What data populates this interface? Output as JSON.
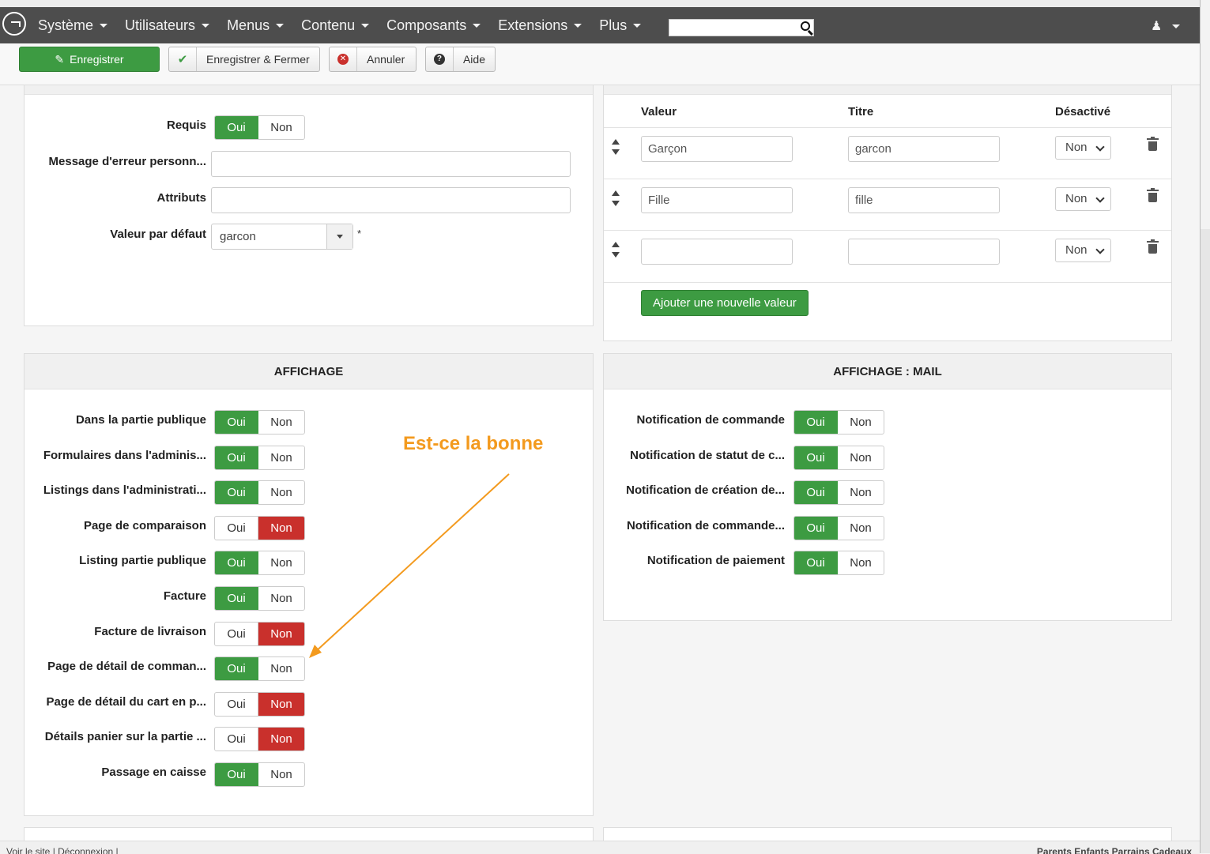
{
  "nav": {
    "items": [
      "Système",
      "Utilisateurs",
      "Menus",
      "Contenu",
      "Composants",
      "Extensions",
      "Plus"
    ],
    "search_placeholder": ""
  },
  "toolbar": {
    "save": "Enregistrer",
    "save_close": "Enregistrer & Fermer",
    "cancel": "Annuler",
    "help": "Aide"
  },
  "field_options": {
    "required_label": "Requis",
    "error_label": "Message d'erreur personn...",
    "attributes_label": "Attributs",
    "default_label": "Valeur par défaut",
    "default_value": "garcon",
    "required_marker": "*"
  },
  "values_table": {
    "headers": {
      "value": "Valeur",
      "title": "Titre",
      "disabled": "Désactivé"
    },
    "rows": [
      {
        "value": "Garçon",
        "title": "garcon",
        "disabled": "Non"
      },
      {
        "value": "Fille",
        "title": "fille",
        "disabled": "Non"
      },
      {
        "value": "",
        "title": "",
        "disabled": "Non"
      }
    ],
    "add_button": "Ajouter une nouvelle valeur"
  },
  "toggle_labels": {
    "yes": "Oui",
    "no": "Non"
  },
  "affichage": {
    "title": "AFFICHAGE",
    "rows": [
      {
        "label": "Dans la partie publique",
        "state": "Oui"
      },
      {
        "label": "Formulaires dans l'adminis...",
        "state": "Oui"
      },
      {
        "label": "Listings dans l'administrati...",
        "state": "Oui"
      },
      {
        "label": "Page de comparaison",
        "state": "Non"
      },
      {
        "label": "Listing partie publique",
        "state": "Oui"
      },
      {
        "label": "Facture",
        "state": "Oui"
      },
      {
        "label": "Facture de livraison",
        "state": "Non"
      },
      {
        "label": "Page de détail de comman...",
        "state": "Oui"
      },
      {
        "label": "Page de détail du cart en p...",
        "state": "Non"
      },
      {
        "label": "Détails panier sur la partie ...",
        "state": "Non"
      },
      {
        "label": "Passage en caisse",
        "state": "Oui"
      }
    ]
  },
  "affichage_mail": {
    "title": "AFFICHAGE : MAIL",
    "rows": [
      {
        "label": "Notification de commande",
        "state": "Oui"
      },
      {
        "label": "Notification de statut de c...",
        "state": "Oui"
      },
      {
        "label": "Notification de création de...",
        "state": "Oui"
      },
      {
        "label": "Notification de commande...",
        "state": "Oui"
      },
      {
        "label": "Notification de paiement",
        "state": "Oui"
      }
    ]
  },
  "annotation": "Est-ce la bonne",
  "footer": {
    "left": "Voir le site  |  Déconnexion  |",
    "right": "Parents  Enfants  Parrains  Cadeaux"
  },
  "colors": {
    "green": "#3d9b42",
    "red": "#c9302c",
    "annotation": "#f39a1e",
    "navbar": "#4d4d4d"
  }
}
